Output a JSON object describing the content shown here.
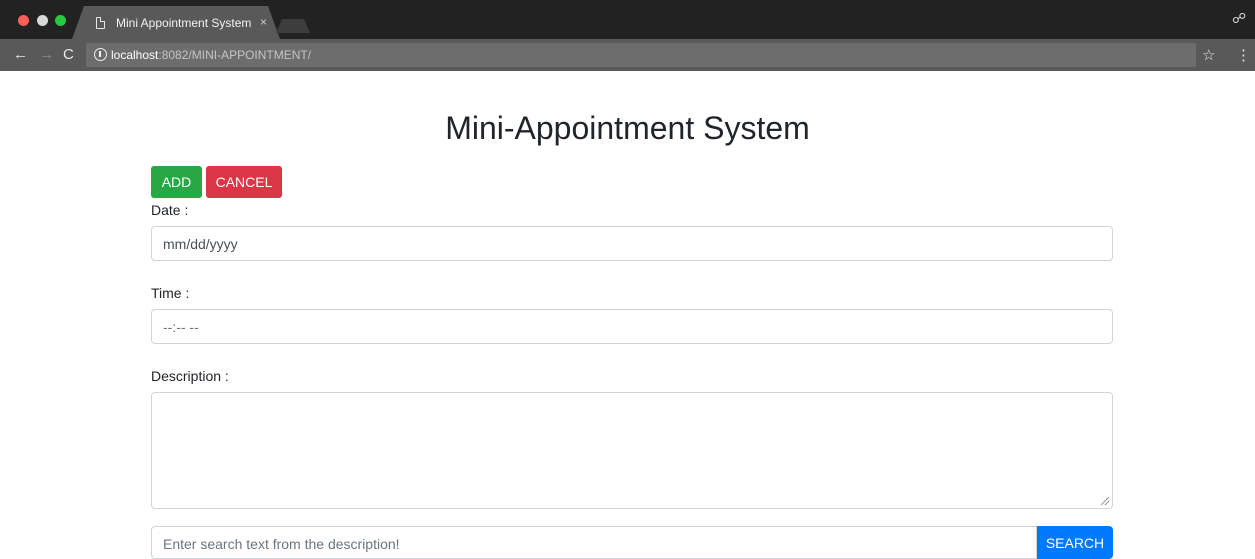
{
  "browser": {
    "tab_title": "Mini Appointment System",
    "tab_close": "×",
    "url_host": "localhost",
    "url_path": ":8082/MINI-APPOINTMENT/"
  },
  "page": {
    "title": "Mini-Appointment System"
  },
  "actions": {
    "add_label": "ADD",
    "cancel_label": "CANCEL",
    "search_label": "SEARCH"
  },
  "form": {
    "date_label": "Date :",
    "date_placeholder": "mm/dd/yyyy",
    "time_label": "Time :",
    "time_placeholder": "--:-- --",
    "description_label": "Description :",
    "description_value": ""
  },
  "search": {
    "placeholder": "Enter search text from the description!"
  },
  "colors": {
    "add": "#28a745",
    "cancel": "#dc3545",
    "search": "#007bff"
  }
}
